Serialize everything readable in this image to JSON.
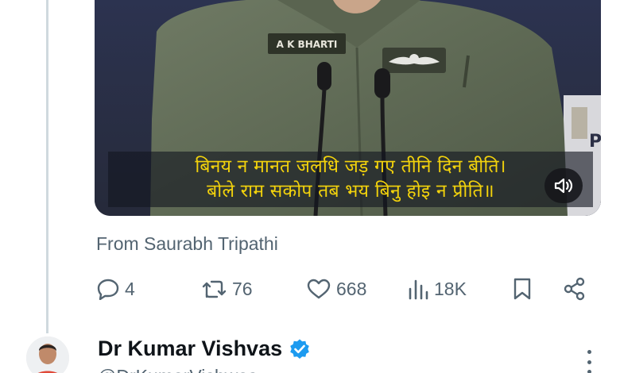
{
  "video": {
    "name_tag": "A K BHARTI",
    "caption_line1": "बिनय न मानत जलधि जड़ गए तीनि दिन बीति।",
    "caption_line2": "बोले राम सकोप तब भय बिनु होइ न प्रीति॥",
    "corner_text": "P",
    "mute_icon": "speaker-muted-icon"
  },
  "attribution": "From Saurabh Tripathi",
  "actions": {
    "reply_count": "4",
    "retweet_count": "76",
    "like_count": "668",
    "views_count": "18K",
    "icons": [
      "reply-icon",
      "retweet-icon",
      "like-icon",
      "views-icon",
      "bookmark-icon",
      "share-icon"
    ]
  },
  "next_tweet": {
    "author_name": "Dr Kumar Vishvas",
    "handle": "@DrKumarVishwas",
    "verified": true
  },
  "colors": {
    "secondary_text": "#536471",
    "verified_blue": "#1d9bf0",
    "caption_yellow": "#f2d20c",
    "thread_line": "#cfd9de"
  }
}
